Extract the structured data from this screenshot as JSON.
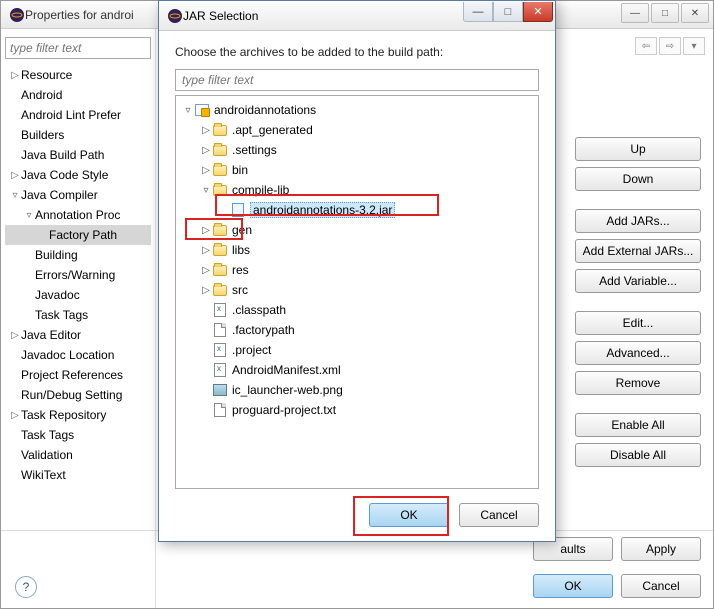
{
  "bg": {
    "title": "Properties for androi",
    "filter_placeholder": "type filter text",
    "tree": [
      {
        "label": "Resource",
        "depth": 1,
        "arrow": "▷"
      },
      {
        "label": "Android",
        "depth": 1,
        "arrow": ""
      },
      {
        "label": "Android Lint Prefer",
        "depth": 1,
        "arrow": ""
      },
      {
        "label": "Builders",
        "depth": 1,
        "arrow": ""
      },
      {
        "label": "Java Build Path",
        "depth": 1,
        "arrow": ""
      },
      {
        "label": "Java Code Style",
        "depth": 1,
        "arrow": "▷"
      },
      {
        "label": "Java Compiler",
        "depth": 1,
        "arrow": "▿"
      },
      {
        "label": "Annotation Proc",
        "depth": 2,
        "arrow": "▿"
      },
      {
        "label": "Factory Path",
        "depth": 3,
        "arrow": "",
        "selected": true
      },
      {
        "label": "Building",
        "depth": 2,
        "arrow": ""
      },
      {
        "label": "Errors/Warning",
        "depth": 2,
        "arrow": ""
      },
      {
        "label": "Javadoc",
        "depth": 2,
        "arrow": ""
      },
      {
        "label": "Task Tags",
        "depth": 2,
        "arrow": ""
      },
      {
        "label": "Java Editor",
        "depth": 1,
        "arrow": "▷"
      },
      {
        "label": "Javadoc Location",
        "depth": 1,
        "arrow": ""
      },
      {
        "label": "Project References",
        "depth": 1,
        "arrow": ""
      },
      {
        "label": "Run/Debug Setting",
        "depth": 1,
        "arrow": ""
      },
      {
        "label": "Task Repository",
        "depth": 1,
        "arrow": "▷"
      },
      {
        "label": "Task Tags",
        "depth": 1,
        "arrow": ""
      },
      {
        "label": "Validation",
        "depth": 1,
        "arrow": ""
      },
      {
        "label": "WikiText",
        "depth": 1,
        "arrow": ""
      }
    ],
    "nav_back": "⇦",
    "nav_fwd": "⇨",
    "nav_menu": "▾",
    "buttons": {
      "up": "Up",
      "down": "Down",
      "add_jars": "Add JARs...",
      "add_ext": "Add External JARs...",
      "add_var": "Add Variable...",
      "edit": "Edit...",
      "advanced": "Advanced...",
      "remove": "Remove",
      "enable": "Enable All",
      "disable": "Disable All",
      "restore": "aults",
      "apply": "Apply",
      "ok": "OK",
      "cancel": "Cancel"
    },
    "help": "?"
  },
  "dlg": {
    "title": "JAR Selection",
    "msg": "Choose the archives to be added to the build path:",
    "filter_placeholder": "type filter text",
    "tree": [
      {
        "label": "androidannotations",
        "depth": 0,
        "arrow": "▿",
        "icon": "proj"
      },
      {
        "label": ".apt_generated",
        "depth": 1,
        "arrow": "▷",
        "icon": "folder"
      },
      {
        "label": ".settings",
        "depth": 1,
        "arrow": "▷",
        "icon": "folder"
      },
      {
        "label": "bin",
        "depth": 1,
        "arrow": "▷",
        "icon": "folder"
      },
      {
        "label": "compile-lib",
        "depth": 1,
        "arrow": "▿",
        "icon": "folder"
      },
      {
        "label": "androidannotations-3.2.jar",
        "depth": 2,
        "arrow": "",
        "icon": "jar",
        "selected": true
      },
      {
        "label": "gen",
        "depth": 1,
        "arrow": "▷",
        "icon": "folder"
      },
      {
        "label": "libs",
        "depth": 1,
        "arrow": "▷",
        "icon": "folder"
      },
      {
        "label": "res",
        "depth": 1,
        "arrow": "▷",
        "icon": "folder"
      },
      {
        "label": "src",
        "depth": 1,
        "arrow": "▷",
        "icon": "folder"
      },
      {
        "label": ".classpath",
        "depth": 1,
        "arrow": "",
        "icon": "xml"
      },
      {
        "label": ".factorypath",
        "depth": 1,
        "arrow": "",
        "icon": "file"
      },
      {
        "label": ".project",
        "depth": 1,
        "arrow": "",
        "icon": "xml"
      },
      {
        "label": "AndroidManifest.xml",
        "depth": 1,
        "arrow": "",
        "icon": "xml"
      },
      {
        "label": "ic_launcher-web.png",
        "depth": 1,
        "arrow": "",
        "icon": "img"
      },
      {
        "label": "proguard-project.txt",
        "depth": 1,
        "arrow": "",
        "icon": "file"
      }
    ],
    "ok": "OK",
    "cancel": "Cancel",
    "win_min": "—",
    "win_max": "□",
    "win_close": "✕"
  }
}
